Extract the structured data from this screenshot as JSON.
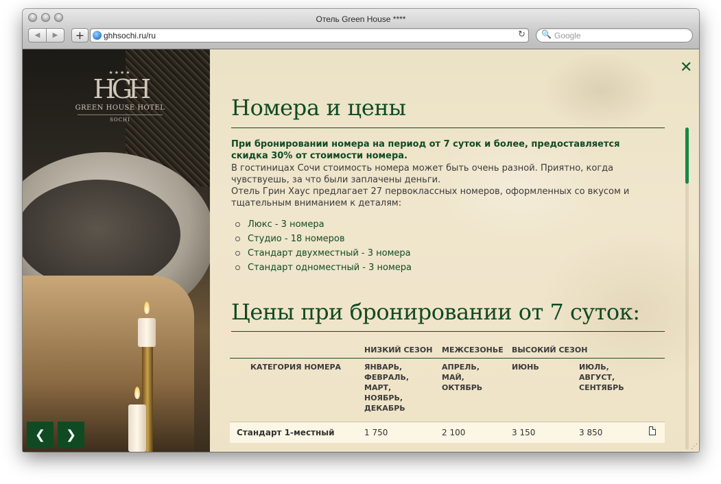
{
  "browser": {
    "window_title": "Отель Green House ****",
    "url": "ghhsochi.ru/ru",
    "search_placeholder": "Google",
    "back_glyph": "◀",
    "forward_glyph": "▶",
    "add_glyph": "+",
    "reload_glyph": "↻",
    "search_glyph": "🔍"
  },
  "logo": {
    "emblem": "HGH",
    "stars": "★★★★",
    "name": "GREEN HOUSE HOTEL",
    "city": "SOCHI"
  },
  "slider": {
    "prev": "❮",
    "next": "❯"
  },
  "close_glyph": "✕",
  "page": {
    "title": "Номера и цены",
    "discount": "При бронировании номера на период от 7 суток и более, предоставляется скидка 30% от стоимости номера.",
    "para1": "В гостиницах Сочи стоимость номера может быть очень разной. Приятно, когда чувствуешь, за что были заплачены деньги.",
    "para2": "Отель Грин Хаус предлагает 27 первоклассных номеров, оформленных со вкусом и тщательным вниманием к деталям:",
    "rooms": [
      "Люкс - 3 номера",
      "Студио - 18 номеров",
      "Стандарт двухместный - 3 номера",
      "Стандарт одноместный - 3 номера"
    ],
    "prices_title": "Цены при бронировании от 7 суток:"
  },
  "table": {
    "season_headers": [
      "НИЗКИЙ СЕЗОН",
      "МЕЖСЕЗОНЬЕ",
      "ВЫСОКИЙ СЕЗОН"
    ],
    "category_header": "КАТЕГОРИЯ НОМЕРА",
    "month_headers": [
      "ЯНВАРЬ,\nФЕВРАЛЬ,\nМАРТ,\nНОЯБРЬ,\nДЕКАБРЬ",
      "АПРЕЛЬ,\nМАЙ,\nОКТЯБРЬ",
      "ИЮНЬ",
      "ИЮЛЬ,\nАВГУСТ,\nСЕНТЯБРЬ"
    ],
    "rows": [
      {
        "category": "Стандарт 1-местный",
        "prices": [
          "1 750",
          "2 100",
          "3 150",
          "3 850"
        ]
      }
    ]
  },
  "colors": {
    "accent": "#0f4a23",
    "panel_bg": "#f0e6cd",
    "scroll_thumb": "#128a44"
  }
}
